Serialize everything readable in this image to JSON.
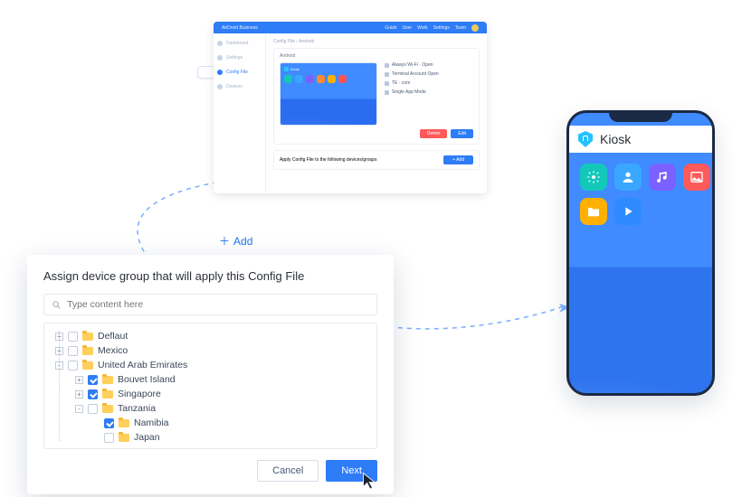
{
  "admin": {
    "brand": "AirDroid Business",
    "topnav": [
      "Guide",
      "User",
      "Work",
      "Settings"
    ],
    "topright": "Team",
    "sidebar": [
      "Dashboard",
      "Settings",
      "Config File",
      "Devices"
    ],
    "sidebar_active_index": 2,
    "breadcrumb": "Config File  ›  Android",
    "panel_title": "Android",
    "preview_label": "Kiosk",
    "specs": [
      "Always Wi-Fi · Open",
      "Terminal Account Open",
      "TE · com",
      "Single App Mode"
    ],
    "btn_delete": "Delete",
    "btn_edit": "Edit",
    "apply_text": "Apply Config File to the following devices/groups",
    "btn_add_small": "+ Add"
  },
  "floating_add": "Add",
  "modal": {
    "title": "Assign device group that will apply this Config File",
    "search_placeholder": "Type content here",
    "tree": [
      {
        "depth": 1,
        "expand": "+",
        "checked": false,
        "label": "Deflaut"
      },
      {
        "depth": 1,
        "expand": "+",
        "checked": false,
        "label": "Mexico"
      },
      {
        "depth": 1,
        "expand": "-",
        "checked": false,
        "label": "United Arab Emirates"
      },
      {
        "depth": 2,
        "expand": "+",
        "checked": true,
        "label": "Bouvet Island"
      },
      {
        "depth": 2,
        "expand": "+",
        "checked": true,
        "label": "Singapore"
      },
      {
        "depth": 2,
        "expand": "-",
        "checked": false,
        "label": "Tanzania"
      },
      {
        "depth": 3,
        "expand": "",
        "checked": true,
        "label": "Namibia"
      },
      {
        "depth": 3,
        "expand": "",
        "checked": false,
        "label": "Japan"
      }
    ],
    "cancel": "Cancel",
    "next": "Next"
  },
  "phone": {
    "title": "Kiosk"
  }
}
